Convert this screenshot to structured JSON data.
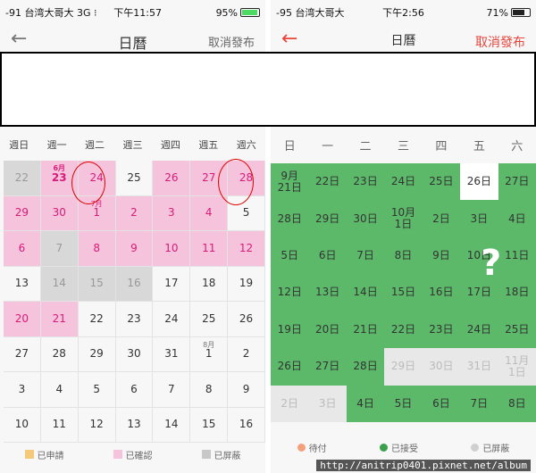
{
  "left": {
    "status": {
      "carrier": "-91 台湾大哥大  3G  ⁝",
      "time": "下午11:57",
      "battery": "95%"
    },
    "nav": {
      "back": "←",
      "title": "日曆",
      "cancel": "取消發布"
    },
    "weekdays": [
      "週日",
      "週一",
      "週二",
      "週三",
      "週四",
      "週五",
      "週六"
    ],
    "rows": [
      [
        {
          "d": "22",
          "s": "gray"
        },
        {
          "d": "23",
          "s": "pink",
          "b": true,
          "m": "6月"
        },
        {
          "d": "24",
          "s": "pink"
        },
        {
          "d": "25",
          "s": ""
        },
        {
          "d": "26",
          "s": "pink"
        },
        {
          "d": "27",
          "s": "pink"
        },
        {
          "d": "28",
          "s": "pink"
        }
      ],
      [
        {
          "d": "29",
          "s": "pink"
        },
        {
          "d": "30",
          "s": "pink"
        },
        {
          "d": "1",
          "s": "pink",
          "m": "7月"
        },
        {
          "d": "2",
          "s": "pink"
        },
        {
          "d": "3",
          "s": "pink"
        },
        {
          "d": "4",
          "s": "pink"
        },
        {
          "d": "5",
          "s": ""
        }
      ],
      [
        {
          "d": "6",
          "s": "pink"
        },
        {
          "d": "7",
          "s": "gray"
        },
        {
          "d": "8",
          "s": "pink"
        },
        {
          "d": "9",
          "s": "pink"
        },
        {
          "d": "10",
          "s": "pink"
        },
        {
          "d": "11",
          "s": "pink"
        },
        {
          "d": "12",
          "s": "pink"
        }
      ],
      [
        {
          "d": "13",
          "s": ""
        },
        {
          "d": "14",
          "s": "gray"
        },
        {
          "d": "15",
          "s": "gray"
        },
        {
          "d": "16",
          "s": "gray"
        },
        {
          "d": "17",
          "s": ""
        },
        {
          "d": "18",
          "s": ""
        },
        {
          "d": "19",
          "s": ""
        }
      ],
      [
        {
          "d": "20",
          "s": "pink"
        },
        {
          "d": "21",
          "s": "pink"
        },
        {
          "d": "22",
          "s": ""
        },
        {
          "d": "23",
          "s": ""
        },
        {
          "d": "24",
          "s": ""
        },
        {
          "d": "25",
          "s": ""
        },
        {
          "d": "26",
          "s": ""
        }
      ],
      [
        {
          "d": "27",
          "s": ""
        },
        {
          "d": "28",
          "s": ""
        },
        {
          "d": "29",
          "s": ""
        },
        {
          "d": "30",
          "s": ""
        },
        {
          "d": "31",
          "s": ""
        },
        {
          "d": "1",
          "s": "",
          "m": "8月"
        },
        {
          "d": "2",
          "s": ""
        }
      ],
      [
        {
          "d": "3",
          "s": ""
        },
        {
          "d": "4",
          "s": ""
        },
        {
          "d": "5",
          "s": ""
        },
        {
          "d": "6",
          "s": ""
        },
        {
          "d": "7",
          "s": ""
        },
        {
          "d": "8",
          "s": ""
        },
        {
          "d": "9",
          "s": ""
        }
      ],
      [
        {
          "d": "10",
          "s": ""
        },
        {
          "d": "11",
          "s": ""
        },
        {
          "d": "12",
          "s": ""
        },
        {
          "d": "13",
          "s": ""
        },
        {
          "d": "14",
          "s": ""
        },
        {
          "d": "15",
          "s": ""
        },
        {
          "d": "16",
          "s": ""
        }
      ]
    ],
    "legend": [
      {
        "label": "已申請",
        "color": "#f5c97a"
      },
      {
        "label": "已確認",
        "color": "#f6c3dc"
      },
      {
        "label": "已屏蔽",
        "color": "#c8c8c8"
      }
    ]
  },
  "right": {
    "status": {
      "carrier": "-95 台湾大哥大",
      "time": "下午2:56",
      "battery": "71%"
    },
    "nav": {
      "back": "←",
      "title": "日曆",
      "cancel": "取消發布"
    },
    "weekdays": [
      "日",
      "一",
      "二",
      "三",
      "四",
      "五",
      "六"
    ],
    "rows": [
      [
        {
          "d": "9月\n21日",
          "s": "g"
        },
        {
          "d": "22日",
          "s": "g"
        },
        {
          "d": "23日",
          "s": "g"
        },
        {
          "d": "24日",
          "s": "g"
        },
        {
          "d": "25日",
          "s": "g"
        },
        {
          "d": "26日",
          "s": "w"
        },
        {
          "d": "27日",
          "s": "g"
        }
      ],
      [
        {
          "d": "28日",
          "s": "g"
        },
        {
          "d": "29日",
          "s": "g"
        },
        {
          "d": "30日",
          "s": "g"
        },
        {
          "d": "10月\n1日",
          "s": "g"
        },
        {
          "d": "2日",
          "s": "g"
        },
        {
          "d": "3日",
          "s": "g"
        },
        {
          "d": "4日",
          "s": "g"
        }
      ],
      [
        {
          "d": "5日",
          "s": "g"
        },
        {
          "d": "6日",
          "s": "g"
        },
        {
          "d": "7日",
          "s": "g"
        },
        {
          "d": "8日",
          "s": "g"
        },
        {
          "d": "9日",
          "s": "g"
        },
        {
          "d": "10日",
          "s": "g"
        },
        {
          "d": "11日",
          "s": "g"
        }
      ],
      [
        {
          "d": "12日",
          "s": "g"
        },
        {
          "d": "13日",
          "s": "g"
        },
        {
          "d": "14日",
          "s": "g"
        },
        {
          "d": "15日",
          "s": "g"
        },
        {
          "d": "16日",
          "s": "g"
        },
        {
          "d": "17日",
          "s": "g"
        },
        {
          "d": "18日",
          "s": "g"
        }
      ],
      [
        {
          "d": "19日",
          "s": "g"
        },
        {
          "d": "20日",
          "s": "g"
        },
        {
          "d": "21日",
          "s": "g"
        },
        {
          "d": "22日",
          "s": "g"
        },
        {
          "d": "23日",
          "s": "g"
        },
        {
          "d": "24日",
          "s": "g"
        },
        {
          "d": "25日",
          "s": "g"
        }
      ],
      [
        {
          "d": "26日",
          "s": "g"
        },
        {
          "d": "27日",
          "s": "g"
        },
        {
          "d": "28日",
          "s": "g"
        },
        {
          "d": "29日",
          "s": "l"
        },
        {
          "d": "30日",
          "s": "l"
        },
        {
          "d": "31日",
          "s": "l"
        },
        {
          "d": "11月\n1日",
          "s": "l"
        }
      ],
      [
        {
          "d": "2日",
          "s": "l"
        },
        {
          "d": "3日",
          "s": "l"
        },
        {
          "d": "4日",
          "s": "g"
        },
        {
          "d": "5日",
          "s": "g"
        },
        {
          "d": "6日",
          "s": "g"
        },
        {
          "d": "7日",
          "s": "g"
        },
        {
          "d": "8日",
          "s": "g"
        }
      ]
    ],
    "overlay": "?",
    "legend": [
      {
        "label": "待付",
        "color": "#f4a07a"
      },
      {
        "label": "已接受",
        "color": "#3aa14a"
      },
      {
        "label": "已屏蔽",
        "color": "#d0d0d0"
      }
    ]
  },
  "colors": {
    "accent_red": "#e8463c",
    "green": "#5cb96a",
    "pink": "#f6c3dc"
  },
  "watermark": "http://anitrip0401.pixnet.net/album"
}
